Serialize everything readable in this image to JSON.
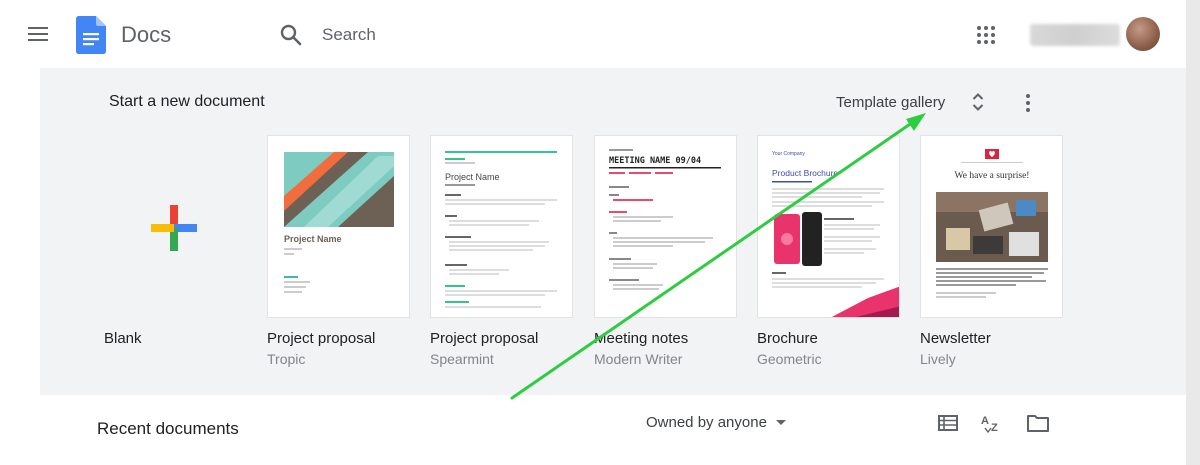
{
  "header": {
    "app_title": "Docs",
    "search_placeholder": "Search",
    "colors": {
      "icon_gray": "#5f6368",
      "docs_blue": "#4285f4"
    }
  },
  "templates": {
    "section_title": "Start a new document",
    "gallery_label": "Template gallery",
    "items": [
      {
        "name": "Blank",
        "subtitle": ""
      },
      {
        "name": "Project proposal",
        "subtitle": "Tropic"
      },
      {
        "name": "Project proposal",
        "subtitle": "Spearmint"
      },
      {
        "name": "Meeting notes",
        "subtitle": "Modern Writer"
      },
      {
        "name": "Brochure",
        "subtitle": "Geometric"
      },
      {
        "name": "Newsletter",
        "subtitle": "Lively"
      }
    ],
    "previews": {
      "tropic_heading": "Project Name",
      "spearmint_heading": "Project Name",
      "meeting_heading": "MEETING NAME 09/04",
      "brochure_small": "Your Company",
      "brochure_heading": "Product Brochure",
      "newsletter_heading": "We have a surprise!"
    }
  },
  "recent": {
    "title": "Recent documents",
    "owner_filter": "Owned by anyone"
  },
  "annotation": {
    "arrow_color": "#2ecc40"
  }
}
